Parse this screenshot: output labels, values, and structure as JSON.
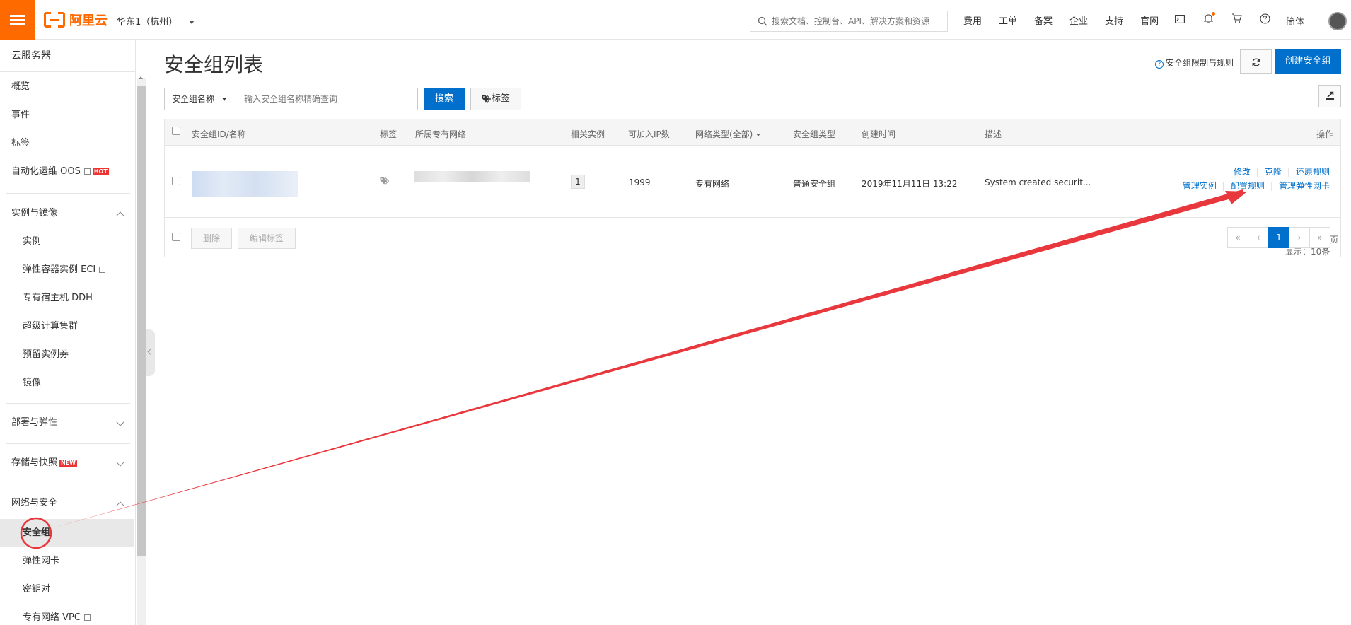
{
  "topbar": {
    "logo_text": "阿里云",
    "region": "华东1（杭州）",
    "search_placeholder": "搜索文档、控制台、API、解决方案和资源",
    "links": [
      "费用",
      "工单",
      "备案",
      "企业",
      "支持",
      "官网"
    ],
    "language": "简体",
    "brand_color": "#ff6a00"
  },
  "sidebar": {
    "header": "云服务器",
    "items": {
      "overview": "概览",
      "events": "事件",
      "tags": "标签",
      "oos": "自动化运维 OOS",
      "oos_badge": "HOT",
      "section_instances": "实例与镜像",
      "instances": "实例",
      "eci": "弹性容器实例 ECI",
      "ddh": "专有宿主机 DDH",
      "supercluster": "超级计算集群",
      "reserved": "预留实例券",
      "images": "镜像",
      "section_deploy": "部署与弹性",
      "section_storage": "存储与快照",
      "storage_badge": "NEW",
      "section_network": "网络与安全",
      "security_group": "安全组",
      "eni": "弹性网卡",
      "keypair": "密钥对",
      "vpc": "专有网络 VPC"
    }
  },
  "main": {
    "title": "安全组列表",
    "limits_link": "安全组限制与规则",
    "create_button": "创建安全组",
    "filter_select": "安全组名称",
    "query_placeholder": "输入安全组名称精确查询",
    "search_button": "搜索",
    "tag_button": "标签",
    "accent_color": "#0070cc"
  },
  "table": {
    "headers": {
      "id_name": "安全组ID/名称",
      "tag": "标签",
      "vpc": "所属专有网络",
      "instances": "相关实例",
      "ip_count": "可加入IP数",
      "net_type": "网络类型(全部)",
      "sg_type": "安全组类型",
      "created": "创建时间",
      "desc": "描述",
      "ops": "操作"
    },
    "row": {
      "instances": "1",
      "ip_count": "1999",
      "net_type": "专有网络",
      "sg_type": "普通安全组",
      "created": "2019年11月11日 13:22",
      "desc": "System created securit...",
      "op_modify": "修改",
      "op_clone": "克隆",
      "op_restore": "还原规则",
      "op_manage_instances": "管理实例",
      "op_config_rules": "配置规则",
      "op_manage_eni": "管理弹性网卡"
    },
    "footer": {
      "delete": "删除",
      "edit_tags": "编辑标签",
      "summary": "共有1条, 每页显示：10条",
      "first": "«",
      "prev": "‹",
      "page": "1",
      "next": "›",
      "last": "»"
    }
  },
  "annotation": {
    "arrow_color": "#e8383d"
  }
}
